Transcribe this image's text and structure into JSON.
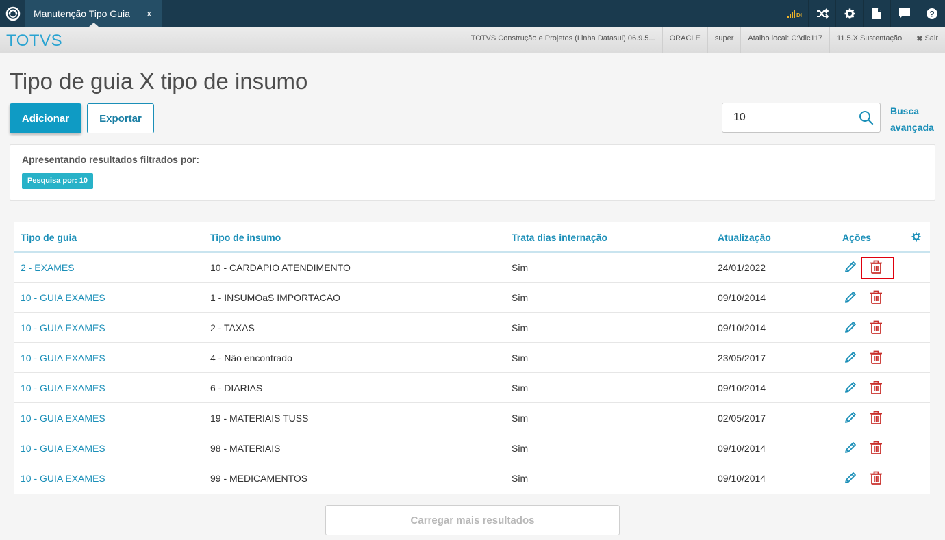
{
  "topbar": {
    "tab_label": "Manutenção Tipo Guia",
    "tab_close": "x",
    "signal_text": "DI"
  },
  "header": {
    "brand": "TOTVS",
    "info": [
      "TOTVS Construção e Projetos (Linha Datasul) 06.9.5...",
      "ORACLE",
      "super",
      "Atalho local: C:\\dlc117",
      "11.5.X Sustentação"
    ],
    "sair": "Sair"
  },
  "page": {
    "title": "Tipo de guia X tipo de insumo",
    "add_label": "Adicionar",
    "export_label": "Exportar",
    "search_value": "10",
    "advanced_search_line1": "Busca",
    "advanced_search_line2": "avançada"
  },
  "filter": {
    "title": "Apresentando resultados filtrados por:",
    "chip": "Pesquisa por: 10"
  },
  "table": {
    "headers": [
      "Tipo de guia",
      "Tipo de insumo",
      "Trata dias internação",
      "Atualização",
      "Ações"
    ],
    "rows": [
      [
        "2 - EXAMES",
        "10 - CARDAPIO ATENDIMENTO",
        "Sim",
        "24/01/2022"
      ],
      [
        "10 - GUIA EXAMES",
        "1 - INSUMOaS IMPORTACAO",
        "Sim",
        "09/10/2014"
      ],
      [
        "10 - GUIA EXAMES",
        "2 - TAXAS",
        "Sim",
        "09/10/2014"
      ],
      [
        "10 - GUIA EXAMES",
        "4 - Não encontrado",
        "Sim",
        "23/05/2017"
      ],
      [
        "10 - GUIA EXAMES",
        "6 - DIARIAS",
        "Sim",
        "09/10/2014"
      ],
      [
        "10 - GUIA EXAMES",
        "19 - MATERIAIS TUSS",
        "Sim",
        "02/05/2017"
      ],
      [
        "10 - GUIA EXAMES",
        "98 - MATERIAIS",
        "Sim",
        "09/10/2014"
      ],
      [
        "10 - GUIA EXAMES",
        "99 - MEDICAMENTOS",
        "Sim",
        "09/10/2014"
      ]
    ]
  },
  "load_more": "Carregar mais resultados",
  "colors": {
    "accent": "#0f9bc4",
    "link": "#1b8fb8",
    "delete": "#c9302c",
    "highlight": "#e0000d"
  }
}
